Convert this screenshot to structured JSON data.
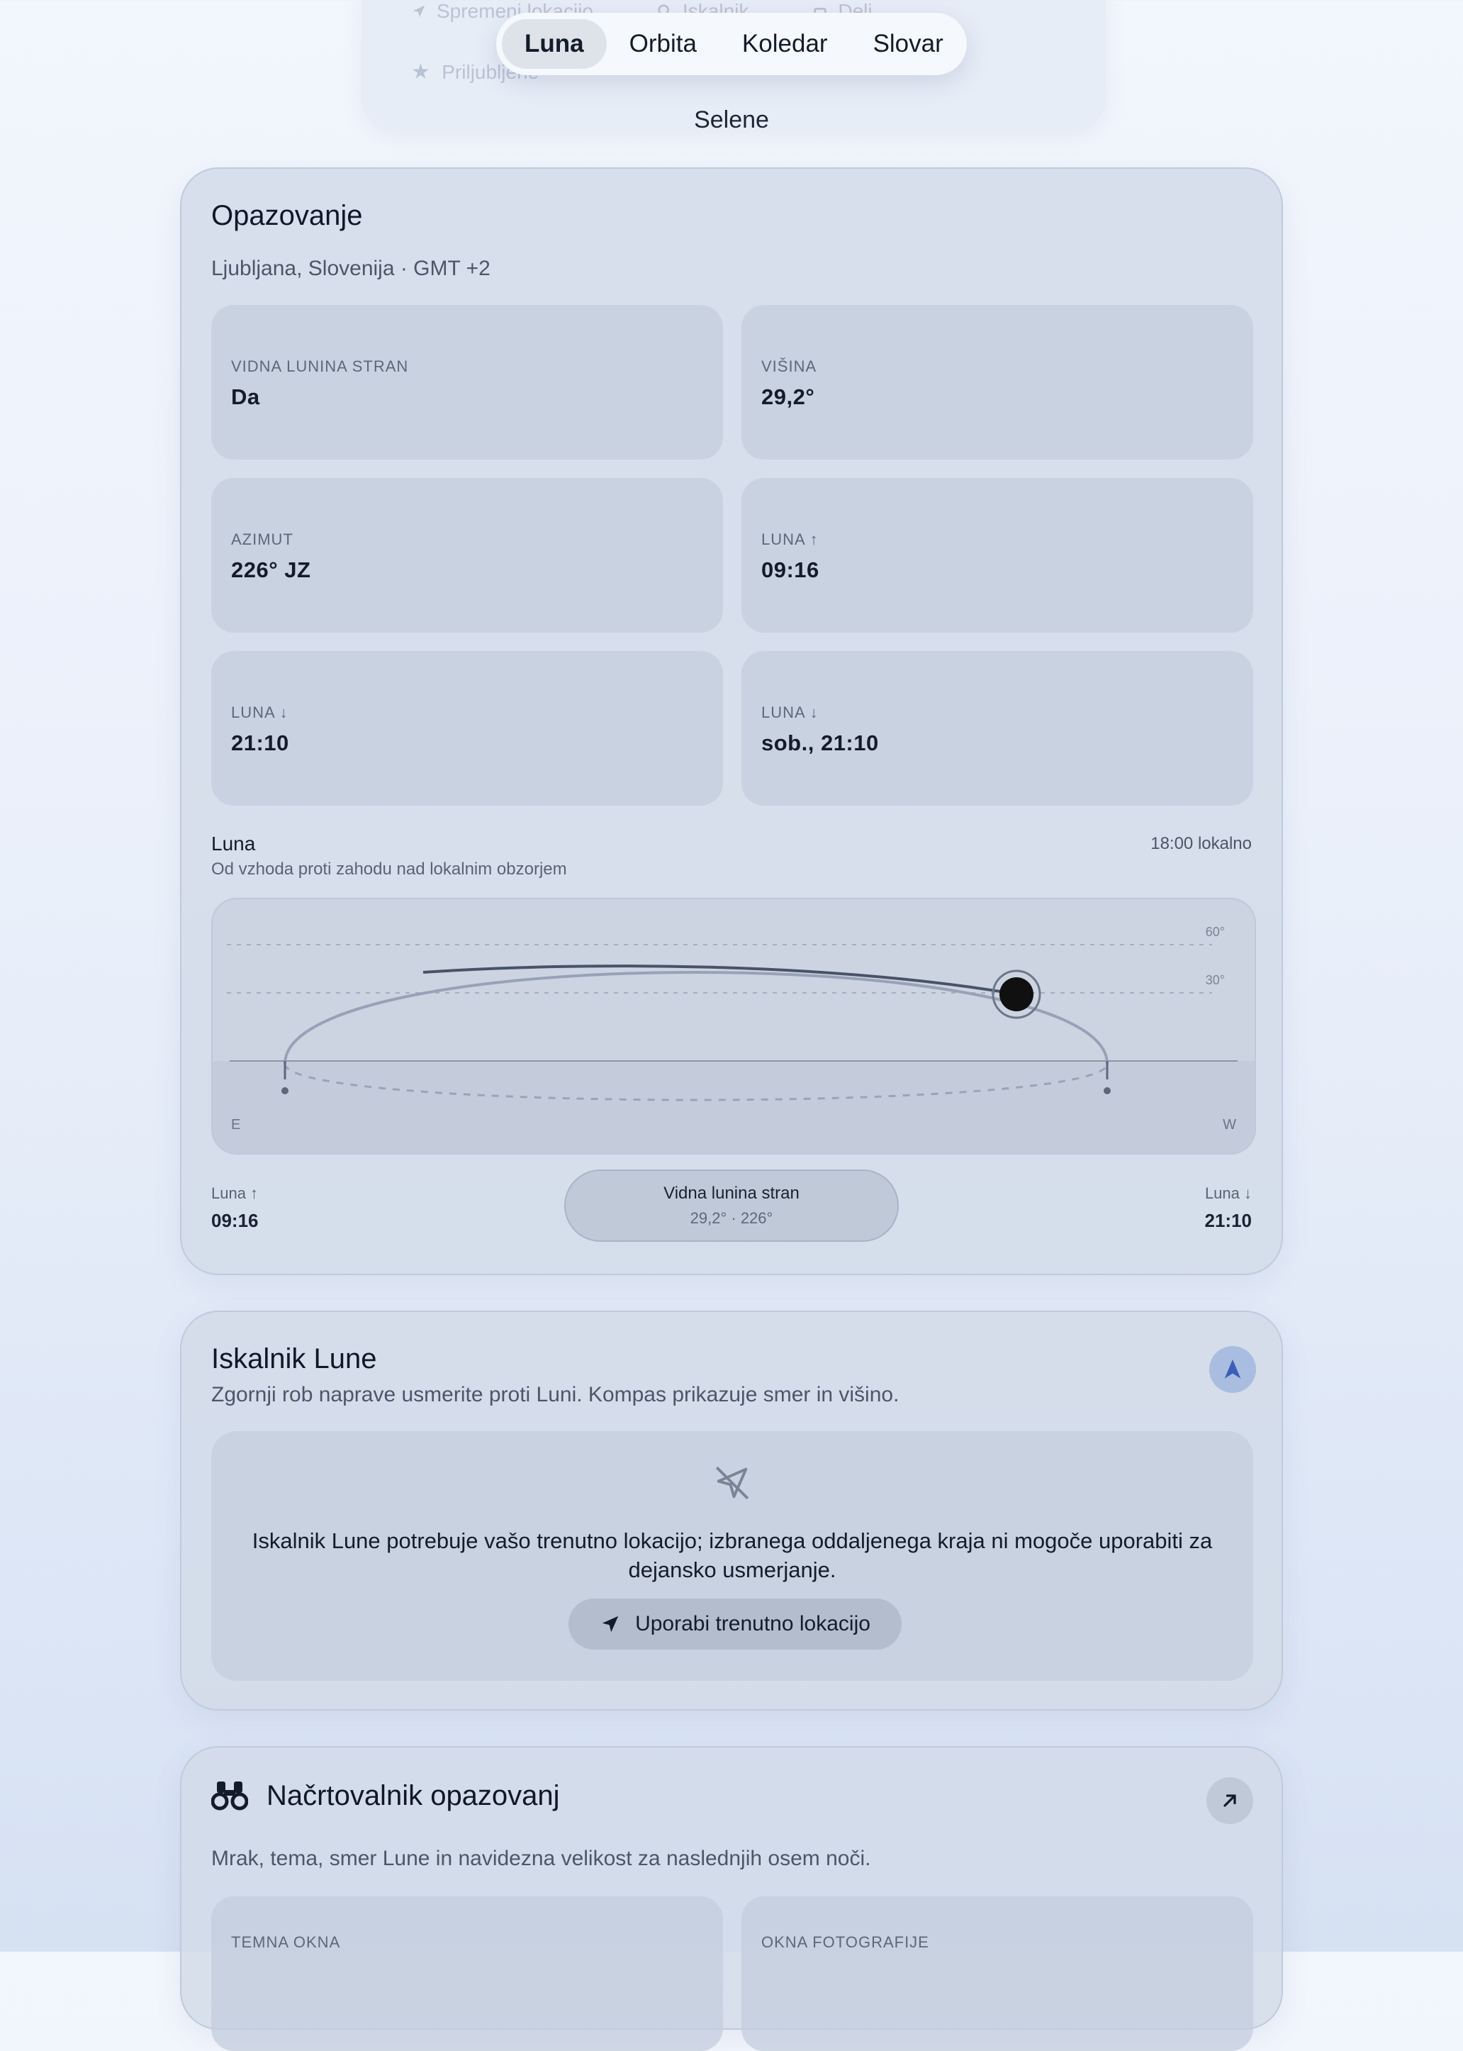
{
  "tabs": [
    "Luna",
    "Orbita",
    "Koledar",
    "Slovar"
  ],
  "active_tab": "Luna",
  "app_title": "Selene",
  "ghost": {
    "item1": "Spremeni lokacijo",
    "item2": "Iskalnik",
    "item3": "Deli",
    "item4": "Priljubljene"
  },
  "observation": {
    "title": "Opazovanje",
    "location": "Ljubljana, Slovenija · GMT +2",
    "tiles": [
      {
        "label": "VIDNA LUNINA STRAN",
        "value": "Da"
      },
      {
        "label": "VIŠINA",
        "value": "29,2°"
      },
      {
        "label": "AZIMUT",
        "value": "226° JZ"
      },
      {
        "label": "LUNA ↑",
        "value": "09:16"
      },
      {
        "label": "LUNA ↓",
        "value": "21:10"
      },
      {
        "label": "LUNA ↓",
        "value": "sob., 21:10"
      }
    ],
    "path": {
      "title": "Luna",
      "subtitle": "Od vzhoda proti zahodu nad lokalnim obzorjem",
      "time": "18:00 lokalno",
      "grid_60": "60°",
      "grid_30": "30°",
      "east": "E",
      "west": "W",
      "moon_altitude_deg": 29.2,
      "moon_azimuth_deg": 226
    },
    "rise_label": "Luna ↑",
    "rise_time": "09:16",
    "set_label": "Luna ↓",
    "set_time": "21:10",
    "status_title": "Vidna lunina stran",
    "status_detail": "29,2° · 226°"
  },
  "finder": {
    "title": "Iskalnik Lune",
    "subtitle": "Zgornji rob naprave usmerite proti Luni. Kompas prikazuje smer in višino.",
    "message": "Iskalnik Lune potrebuje vašo trenutno lokacijo; izbranega oddaljenega kraja ni mogoče uporabiti za dejansko usmerjanje.",
    "button": "Uporabi trenutno lokacijo"
  },
  "planner": {
    "title": "Načrtovalnik opazovanj",
    "subtitle": "Mrak, tema, smer Lune in navidezna velikost za naslednjih osem noči.",
    "tile1": "TEMNA OKNA",
    "tile2": "OKNA FOTOGRAFIJE"
  },
  "colors": {
    "accent": "#3a5fb8",
    "moon": "#101010",
    "arc": "#4a5568"
  }
}
